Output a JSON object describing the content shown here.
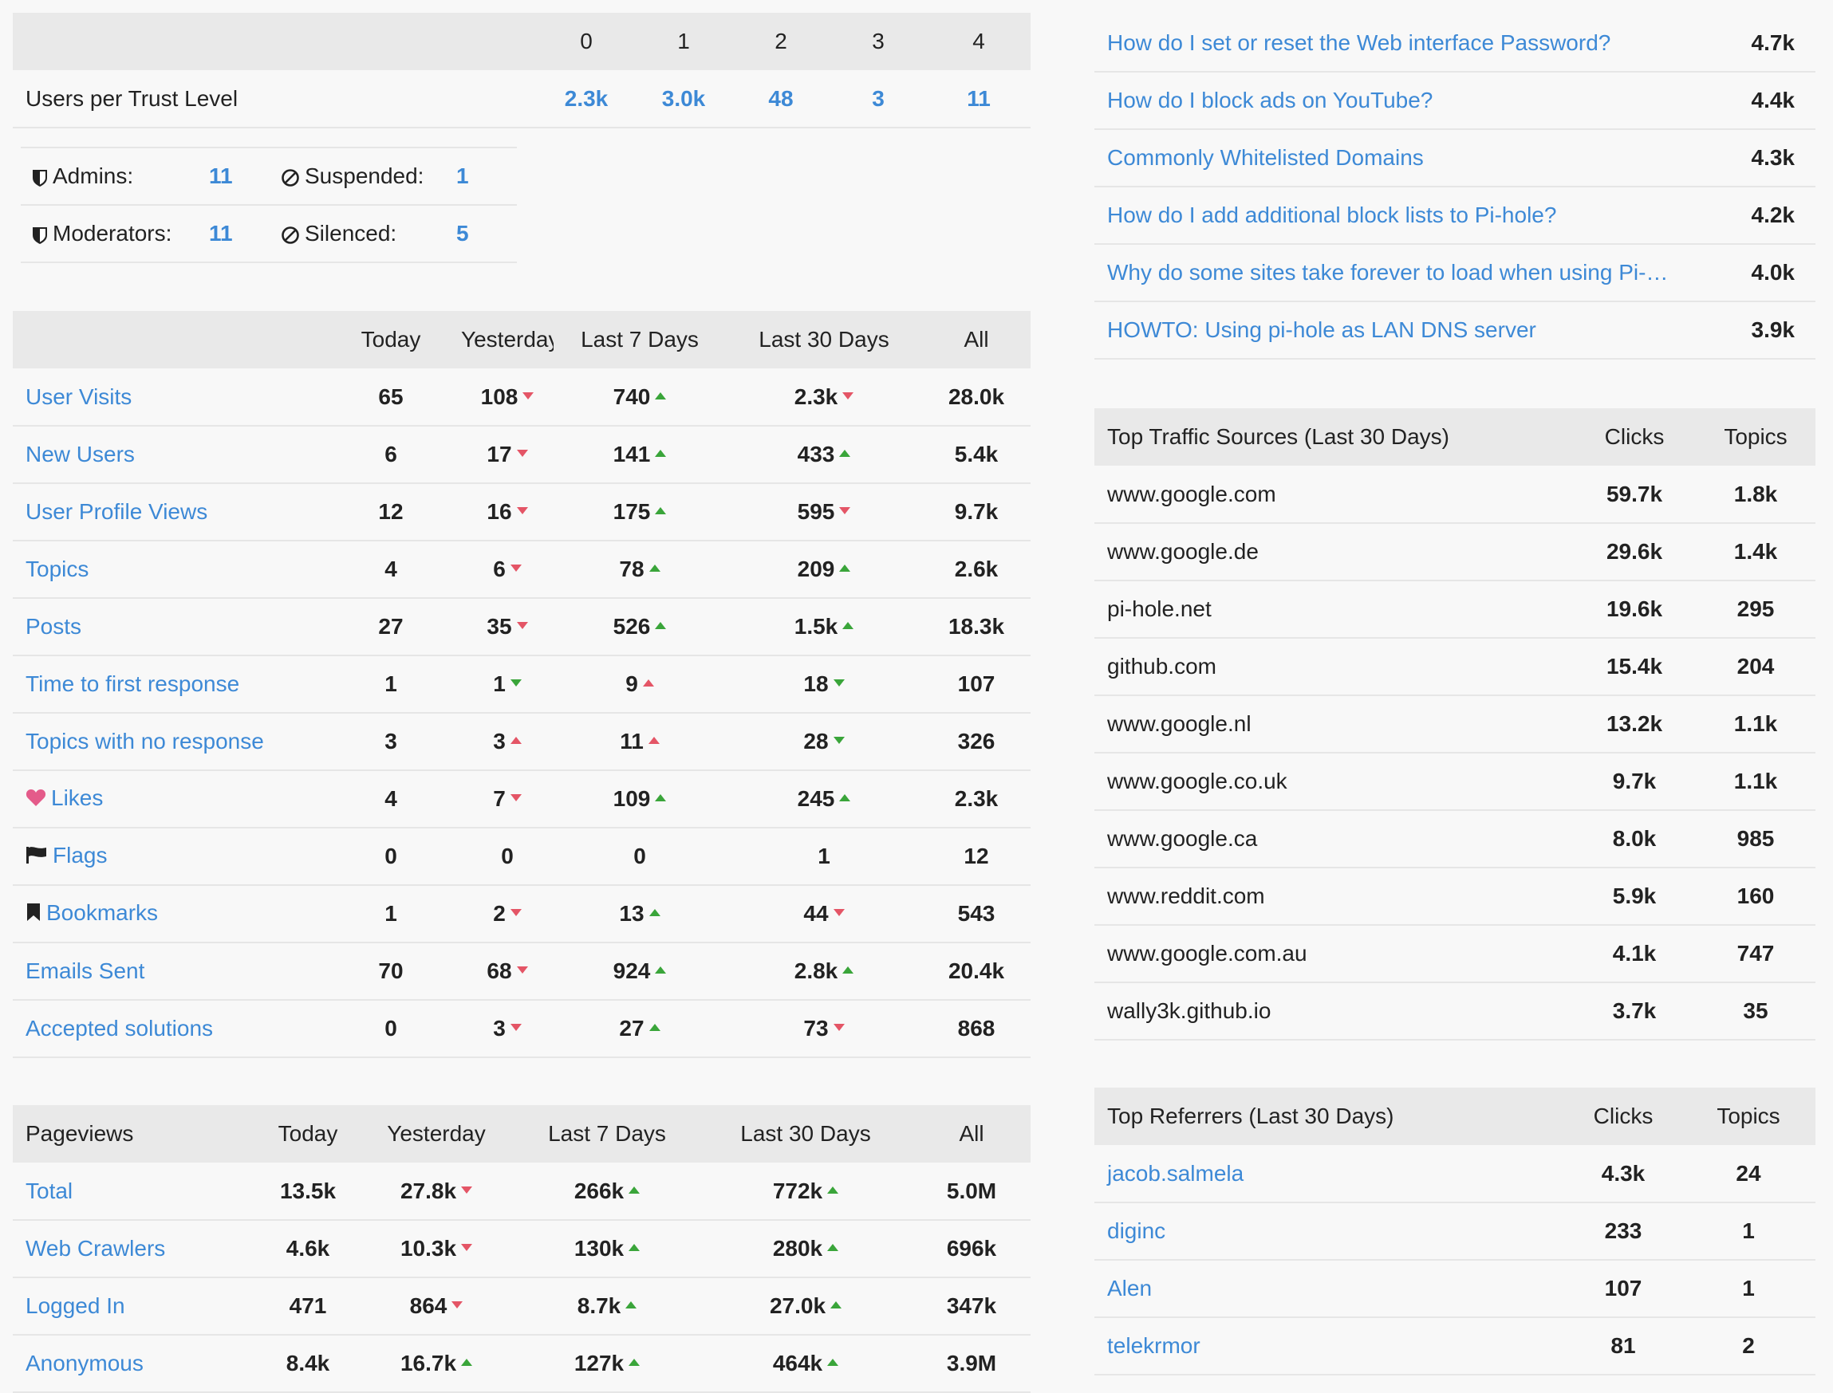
{
  "trust": {
    "levels": [
      "0",
      "1",
      "2",
      "3",
      "4"
    ],
    "row_label": "Users per Trust Level",
    "values": [
      "2.3k",
      "3.0k",
      "48",
      "3",
      "11"
    ]
  },
  "roles": {
    "admins_label": "Admins:",
    "admins": "11",
    "suspended_label": "Suspended:",
    "suspended": "1",
    "moderators_label": "Moderators:",
    "moderators": "11",
    "silenced_label": "Silenced:",
    "silenced": "5"
  },
  "activity": {
    "headers": [
      "Today",
      "Yesterday",
      "Last 7 Days",
      "Last 30 Days",
      "All"
    ],
    "rows": [
      {
        "label": "User Visits",
        "icon": "",
        "today": "65",
        "yesterday": "108",
        "y_trend": "down",
        "week": "740",
        "w_trend": "up",
        "month": "2.3k",
        "m_trend": "down",
        "all": "28.0k"
      },
      {
        "label": "New Users",
        "icon": "",
        "today": "6",
        "yesterday": "17",
        "y_trend": "down",
        "week": "141",
        "w_trend": "up",
        "month": "433",
        "m_trend": "up",
        "all": "5.4k"
      },
      {
        "label": "User Profile Views",
        "icon": "",
        "today": "12",
        "yesterday": "16",
        "y_trend": "down",
        "week": "175",
        "w_trend": "up",
        "month": "595",
        "m_trend": "down",
        "all": "9.7k"
      },
      {
        "label": "Topics",
        "icon": "",
        "today": "4",
        "yesterday": "6",
        "y_trend": "down",
        "week": "78",
        "w_trend": "up",
        "month": "209",
        "m_trend": "up",
        "all": "2.6k"
      },
      {
        "label": "Posts",
        "icon": "",
        "today": "27",
        "yesterday": "35",
        "y_trend": "down",
        "week": "526",
        "w_trend": "up",
        "month": "1.5k",
        "m_trend": "up",
        "all": "18.3k"
      },
      {
        "label": "Time to first response",
        "icon": "",
        "today": "1",
        "yesterday": "1",
        "y_trend": "down-green",
        "week": "9",
        "w_trend": "up-red",
        "month": "18",
        "m_trend": "down-green",
        "all": "107"
      },
      {
        "label": "Topics with no response",
        "icon": "",
        "today": "3",
        "yesterday": "3",
        "y_trend": "up-red",
        "week": "11",
        "w_trend": "up-red",
        "month": "28",
        "m_trend": "down-green",
        "all": "326"
      },
      {
        "label": "Likes",
        "icon": "heart-icon",
        "today": "4",
        "yesterday": "7",
        "y_trend": "down",
        "week": "109",
        "w_trend": "up",
        "month": "245",
        "m_trend": "up",
        "all": "2.3k"
      },
      {
        "label": "Flags",
        "icon": "flag-icon",
        "today": "0",
        "yesterday": "0",
        "y_trend": "",
        "week": "0",
        "w_trend": "",
        "month": "1",
        "m_trend": "",
        "all": "12"
      },
      {
        "label": "Bookmarks",
        "icon": "bookmark-icon",
        "today": "1",
        "yesterday": "2",
        "y_trend": "down",
        "week": "13",
        "w_trend": "up",
        "month": "44",
        "m_trend": "down",
        "all": "543"
      },
      {
        "label": "Emails Sent",
        "icon": "",
        "today": "70",
        "yesterday": "68",
        "y_trend": "down",
        "week": "924",
        "w_trend": "up",
        "month": "2.8k",
        "m_trend": "up",
        "all": "20.4k"
      },
      {
        "label": "Accepted solutions",
        "icon": "",
        "today": "0",
        "yesterday": "3",
        "y_trend": "down",
        "week": "27",
        "w_trend": "up",
        "month": "73",
        "m_trend": "down",
        "all": "868"
      }
    ]
  },
  "pageviews": {
    "headers": [
      "Pageviews",
      "Today",
      "Yesterday",
      "Last 7 Days",
      "Last 30 Days",
      "All"
    ],
    "rows": [
      {
        "label": "Total",
        "today": "13.5k",
        "yesterday": "27.8k",
        "y_trend": "down",
        "week": "266k",
        "w_trend": "up",
        "month": "772k",
        "m_trend": "up",
        "all": "5.0M"
      },
      {
        "label": "Web Crawlers",
        "today": "4.6k",
        "yesterday": "10.3k",
        "y_trend": "down",
        "week": "130k",
        "w_trend": "up",
        "month": "280k",
        "m_trend": "up",
        "all": "696k"
      },
      {
        "label": "Logged In",
        "today": "471",
        "yesterday": "864",
        "y_trend": "down",
        "week": "8.7k",
        "w_trend": "up",
        "month": "27.0k",
        "m_trend": "up",
        "all": "347k"
      },
      {
        "label": "Anonymous",
        "today": "8.4k",
        "yesterday": "16.7k",
        "y_trend": "up",
        "week": "127k",
        "w_trend": "up",
        "month": "464k",
        "m_trend": "up",
        "all": "3.9M"
      }
    ]
  },
  "top_topics": [
    {
      "title": "How do I set or reset the Web interface Password?",
      "views": "4.7k"
    },
    {
      "title": "How do I block ads on YouTube?",
      "views": "4.4k"
    },
    {
      "title": "Commonly Whitelisted Domains",
      "views": "4.3k"
    },
    {
      "title": "How do I add additional block lists to Pi-hole?",
      "views": "4.2k"
    },
    {
      "title": "Why do some sites take forever to load when using Pi-…",
      "views": "4.0k"
    },
    {
      "title": "HOWTO: Using pi-hole as LAN DNS server",
      "views": "3.9k"
    }
  ],
  "traffic": {
    "headers": [
      "Top Traffic Sources (Last 30 Days)",
      "Clicks",
      "Topics"
    ],
    "rows": [
      {
        "domain": "www.google.com",
        "clicks": "59.7k",
        "topics": "1.8k"
      },
      {
        "domain": "www.google.de",
        "clicks": "29.6k",
        "topics": "1.4k"
      },
      {
        "domain": "pi-hole.net",
        "clicks": "19.6k",
        "topics": "295"
      },
      {
        "domain": "github.com",
        "clicks": "15.4k",
        "topics": "204"
      },
      {
        "domain": "www.google.nl",
        "clicks": "13.2k",
        "topics": "1.1k"
      },
      {
        "domain": "www.google.co.uk",
        "clicks": "9.7k",
        "topics": "1.1k"
      },
      {
        "domain": "www.google.ca",
        "clicks": "8.0k",
        "topics": "985"
      },
      {
        "domain": "www.reddit.com",
        "clicks": "5.9k",
        "topics": "160"
      },
      {
        "domain": "www.google.com.au",
        "clicks": "4.1k",
        "topics": "747"
      },
      {
        "domain": "wally3k.github.io",
        "clicks": "3.7k",
        "topics": "35"
      }
    ]
  },
  "referrers": {
    "headers": [
      "Top Referrers (Last 30 Days)",
      "Clicks",
      "Topics"
    ],
    "rows": [
      {
        "user": "jacob.salmela",
        "clicks": "4.3k",
        "topics": "24"
      },
      {
        "user": "diginc",
        "clicks": "233",
        "topics": "1"
      },
      {
        "user": "Alen",
        "clicks": "107",
        "topics": "1"
      },
      {
        "user": "telekrmor",
        "clicks": "81",
        "topics": "2"
      }
    ]
  },
  "colors": {
    "link": "#3d89d6",
    "up": "#3aa53a",
    "down": "#e45566",
    "header_bg": "#e9e9e9"
  }
}
